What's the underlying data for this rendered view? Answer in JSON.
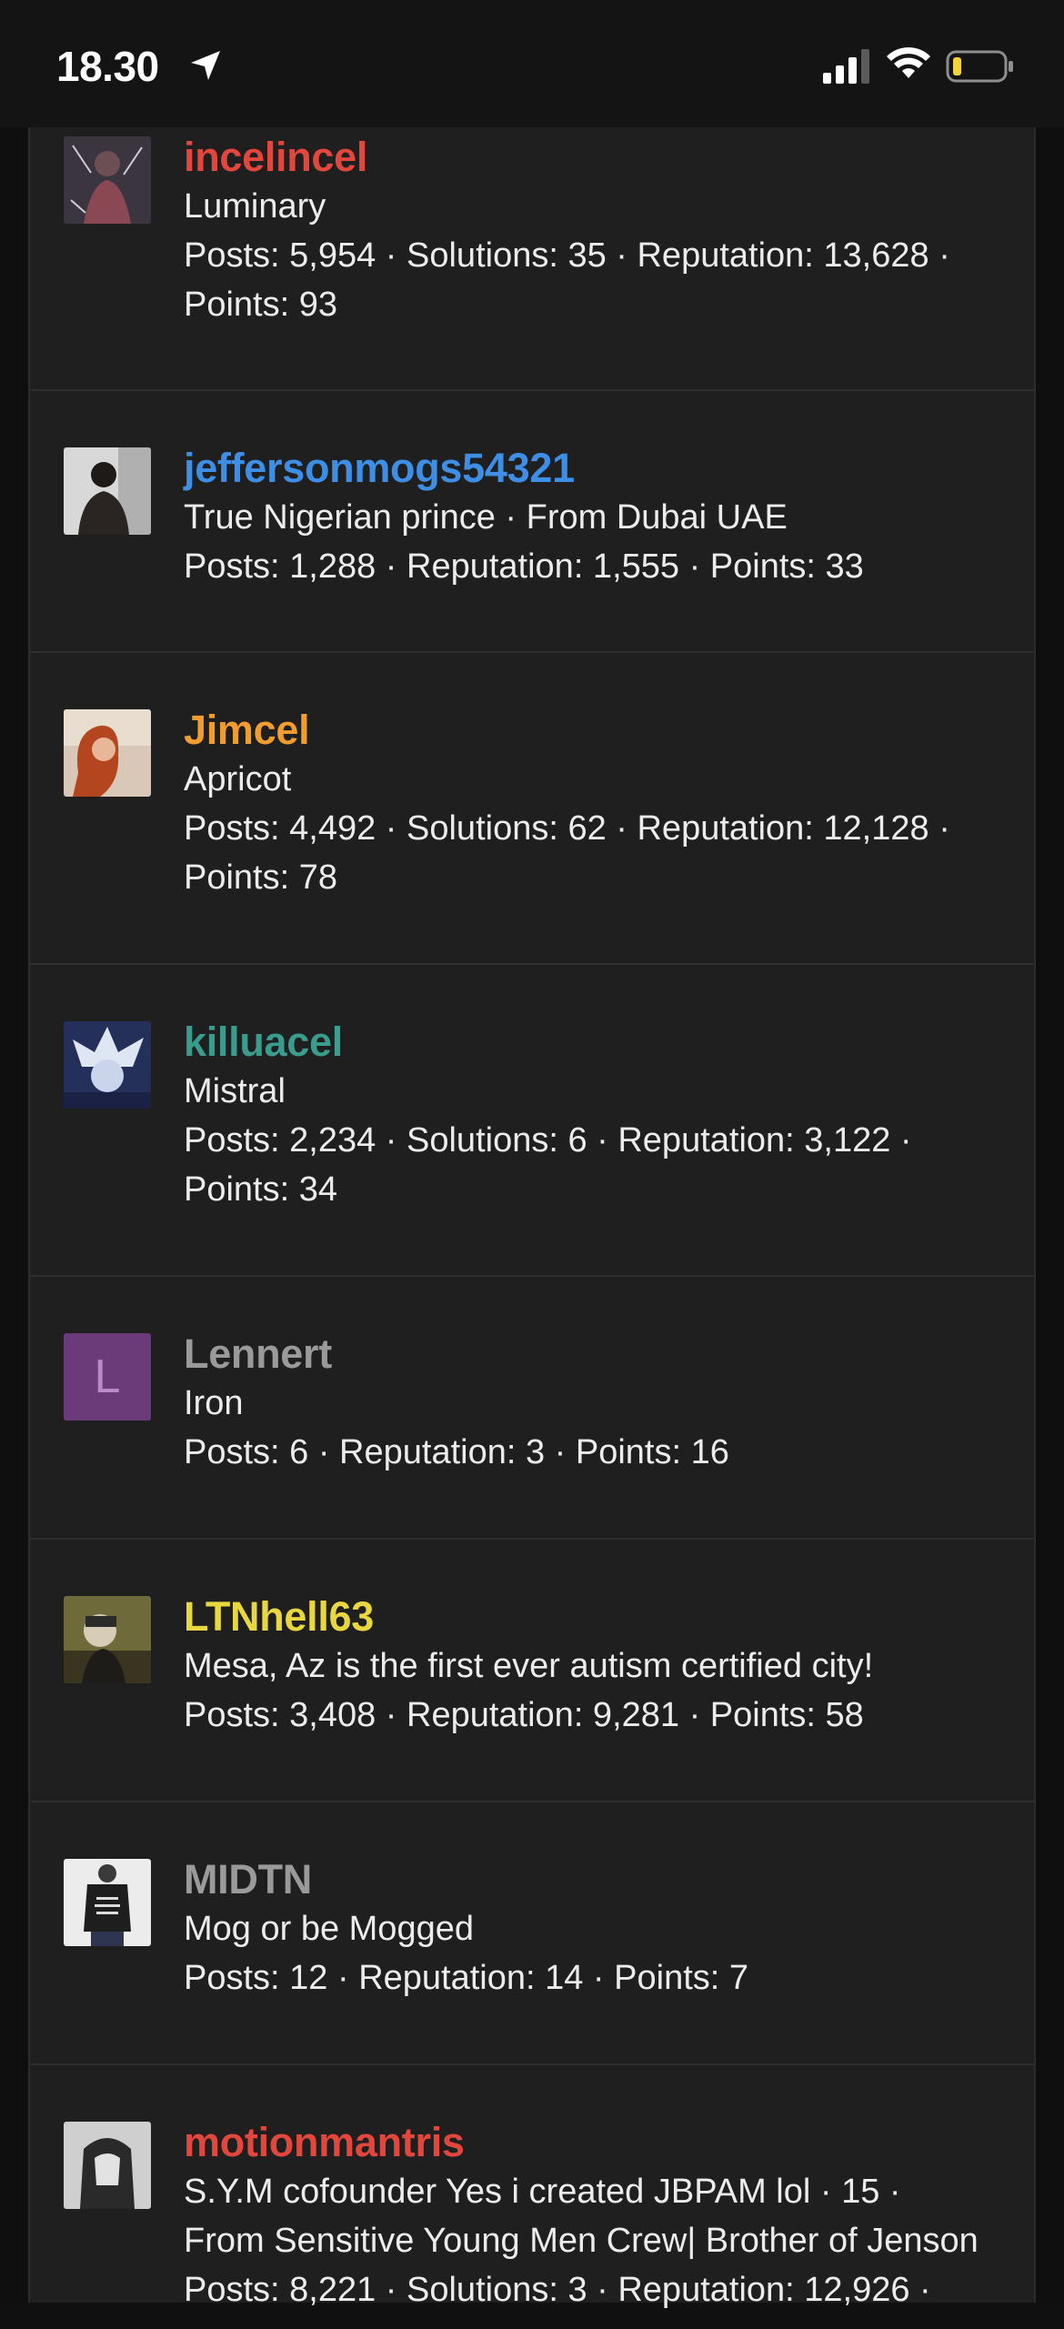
{
  "status_bar": {
    "time": "18.30"
  },
  "colors": {
    "red": "#e1473c",
    "blue": "#3f8ee5",
    "orange": "#f19c2e",
    "teal": "#3a9c8c",
    "grey": "#9a9a9a",
    "yellow": "#e8d73f",
    "panel": "#1f1f20"
  },
  "members": [
    {
      "username": "incelincel",
      "color": "#e1473c",
      "title": "Luminary",
      "stats_line1": "Posts: 5,954 · Solutions: 35 · Reputation: 13,628 ·",
      "stats_line2": "Points: 93",
      "avatar": "photo-avatar"
    },
    {
      "username": "jeffersonmogs54321",
      "color": "#3f8ee5",
      "title": "True Nigerian prince · From Dubai UAE",
      "stats_line1": "Posts: 1,288 · Reputation: 1,555 · Points: 33",
      "stats_line2": "",
      "avatar": "photo-avatar"
    },
    {
      "username": "Jimcel",
      "color": "#f19c2e",
      "title": "Apricot",
      "stats_line1": "Posts: 4,492 · Solutions: 62 · Reputation: 12,128 ·",
      "stats_line2": "Points: 78",
      "avatar": "photo-avatar"
    },
    {
      "username": "killuacel",
      "color": "#3a9c8c",
      "title": "Mistral",
      "stats_line1": "Posts: 2,234 · Solutions: 6 · Reputation: 3,122 ·",
      "stats_line2": "Points: 34",
      "avatar": "photo-avatar"
    },
    {
      "username": "Lennert",
      "color": "#9a9a9a",
      "title": "Iron",
      "stats_line1": "Posts: 6 · Reputation: 3 · Points: 16",
      "stats_line2": "",
      "avatar_letter": "L"
    },
    {
      "username": "LTNhell63",
      "color": "#e8d73f",
      "title": "Mesa, Az is the first ever autism certified city!",
      "stats_line1": "Posts: 3,408 · Reputation: 9,281 · Points: 58",
      "stats_line2": "",
      "avatar": "photo-avatar"
    },
    {
      "username": "MIDTN",
      "color": "#9a9a9a",
      "title": "Mog or be Mogged",
      "stats_line1": "Posts: 12 · Reputation: 14 · Points: 7",
      "stats_line2": "",
      "avatar": "photo-avatar"
    },
    {
      "username": "motionmantris",
      "color": "#e1473c",
      "title": "S.Y.M cofounder Yes i created JBPAM lol · 15 ·",
      "title_line2": "From Sensitive Young Men Crew| Brother of Jenson",
      "stats_line1": "Posts: 8,221 · Solutions: 3 · Reputation: 12,926 ·",
      "stats_line2": "",
      "avatar": "photo-avatar"
    }
  ]
}
